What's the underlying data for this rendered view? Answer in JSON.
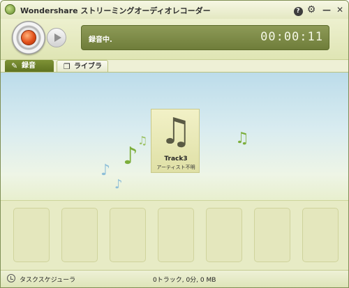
{
  "window": {
    "title": "Wondershare ストリーミングオーディオレコーダー",
    "help_label": "?",
    "settings_label": "⚙",
    "minimize_label": "—",
    "close_label": "✕"
  },
  "recorder": {
    "status": "録音中.",
    "timer": "00:00:11"
  },
  "tabs": [
    {
      "label": "録音",
      "icon": "pencil-icon",
      "active": true
    },
    {
      "label": "ライブラリ",
      "icon": "library-icon",
      "active": false
    }
  ],
  "track": {
    "title": "Track3",
    "artist": "アーティスト不明"
  },
  "statusbar": {
    "scheduler_label": "タスクスケジューラ",
    "summary": "0トラック, 0分, 0 MB"
  },
  "colors": {
    "accent": "#6f7d3a",
    "record": "#e2501a"
  }
}
